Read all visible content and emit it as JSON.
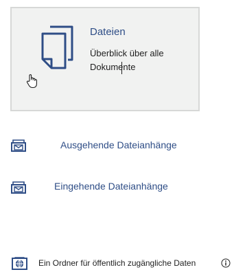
{
  "card": {
    "title": "Dateien",
    "description": "Überblick über alle Dokumente",
    "icon": "documents-icon"
  },
  "links": {
    "outgoing_label": "Ausgehende Dateianhänge",
    "incoming_label": "Eingehende Dateianhänge",
    "icon": "mail-icon"
  },
  "public_folder": {
    "label": "Ein Ordner für öffentlich zugängliche Daten",
    "icon": "globe-folder-icon",
    "info_icon": "info-icon"
  },
  "colors": {
    "accent": "#2e4d86",
    "card_background": "#f1f2f1",
    "card_border": "#d7d8d7"
  }
}
